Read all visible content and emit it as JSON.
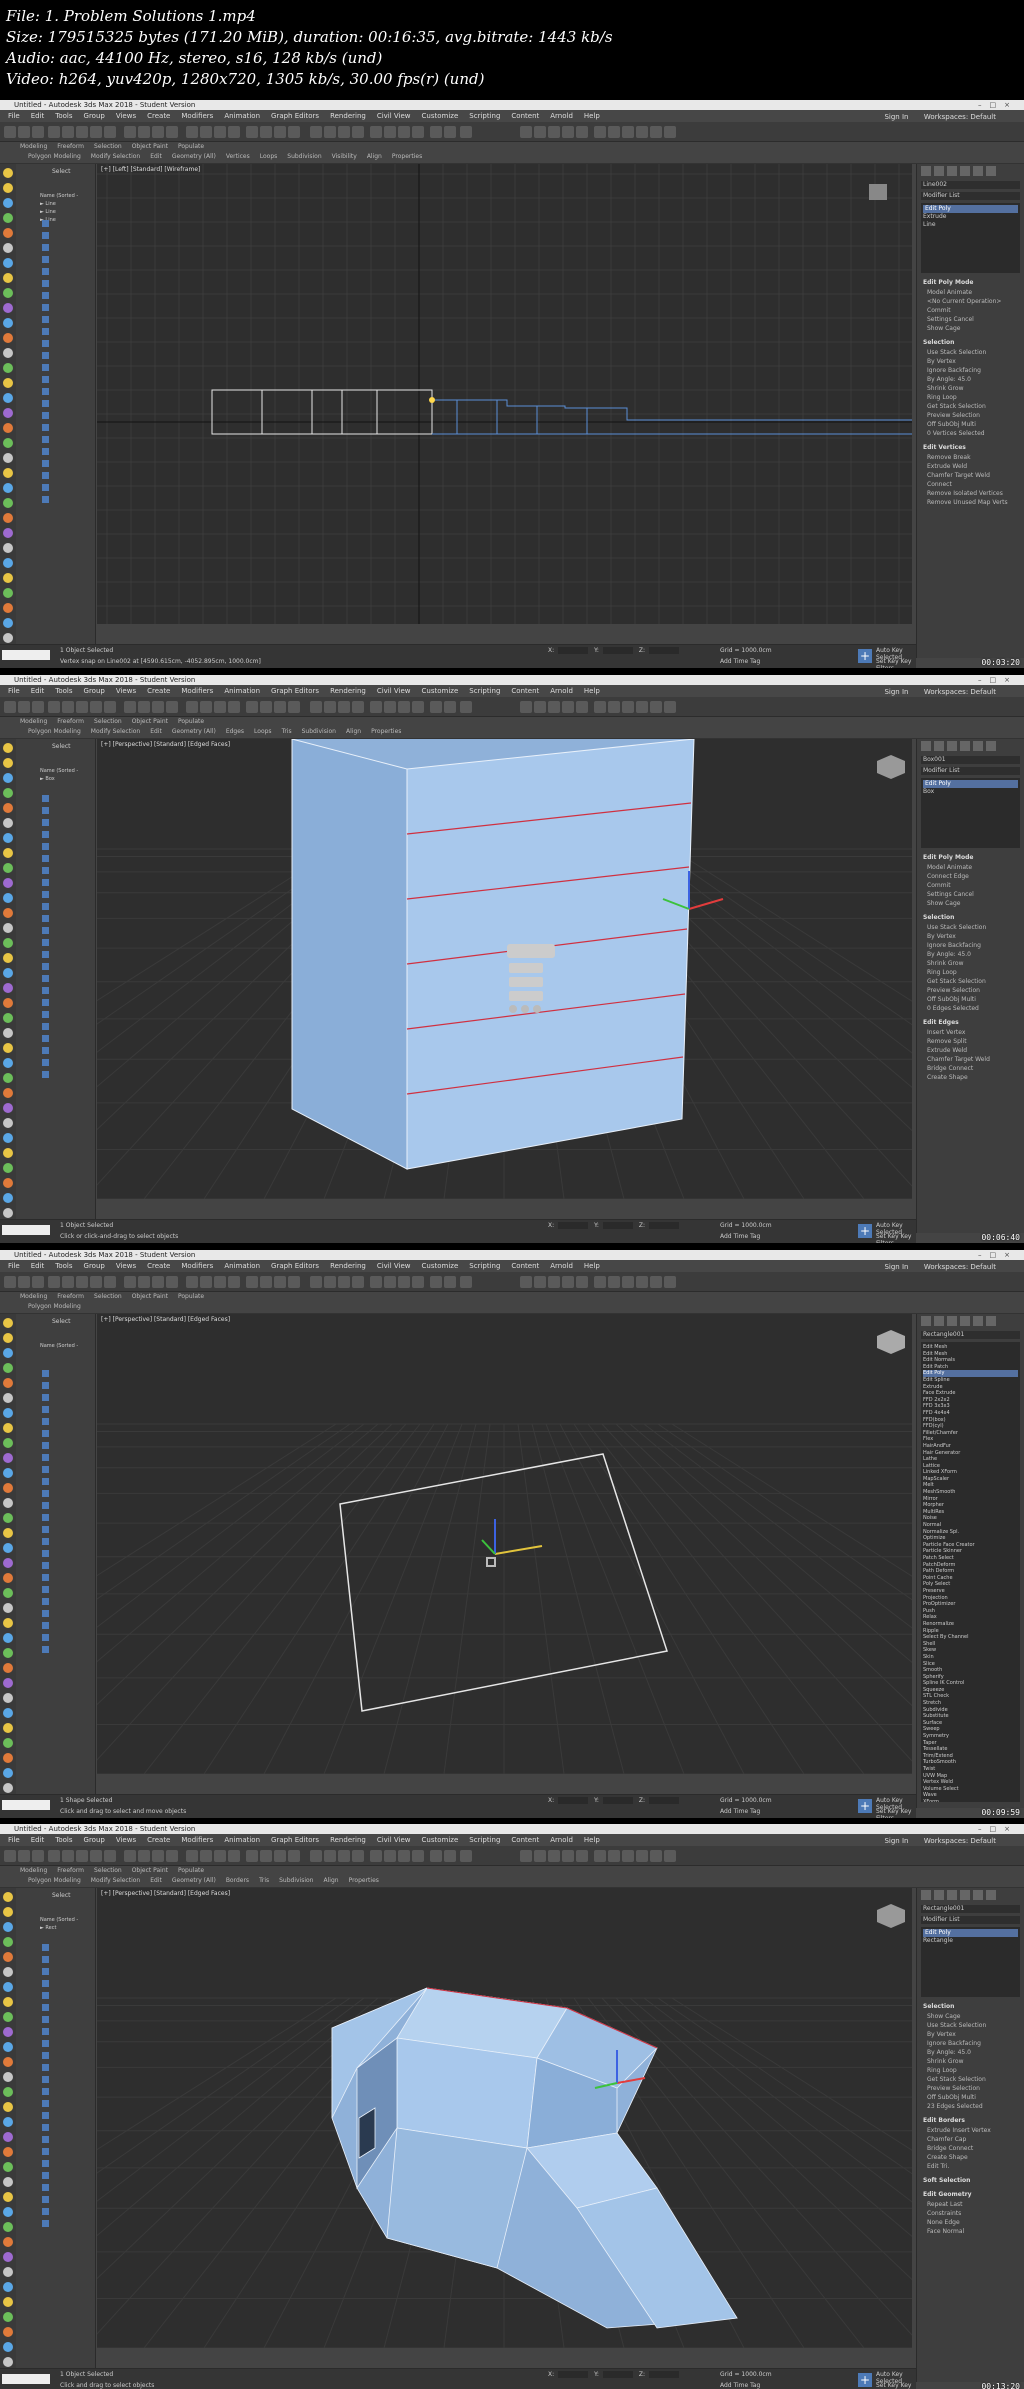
{
  "info": {
    "line1": "File: 1. Problem  Solutions 1.mp4",
    "line2": "Size: 179515325 bytes (171.20 MiB), duration: 00:16:35, avg.bitrate: 1443 kb/s",
    "line3": "Audio: aac, 44100 Hz, stereo, s16, 128 kb/s (und)",
    "line4": "Video: h264, yuv420p, 1280x720, 1305 kb/s, 30.00 fps(r) (und)"
  },
  "app": {
    "title": "Untitled - Autodesk 3ds Max 2018 - Student Version",
    "menus": [
      "File",
      "Edit",
      "Tools",
      "Group",
      "Views",
      "Create",
      "Modifiers",
      "Animation",
      "Graph Editors",
      "Rendering",
      "Civil View",
      "Customize",
      "Scripting",
      "Content",
      "Arnold",
      "Help"
    ],
    "signin": "Sign In",
    "workspaces": "Workspaces:  Default",
    "ribbon_tabs": [
      "Modeling",
      "Freeform",
      "Selection",
      "Object Paint",
      "Populate"
    ],
    "scene_select": "Select",
    "scene_name_col": "Name (Sorted -"
  },
  "frames": [
    {
      "id": "frame-1",
      "viewport_label": "[+] [Left] [Standard] [Wireframe]",
      "ribbon_sub": [
        "Polygon Modeling",
        "Modify Selection",
        "Edit",
        "Geometry (All)",
        "Vertices",
        "Loops",
        "Subdivision",
        "Visibility",
        "Align",
        "Properties"
      ],
      "object_name": "Line002",
      "modifier_list": "Modifier List",
      "stack": [
        "Edit Poly",
        "Extrude",
        "Line"
      ],
      "panel": [
        {
          "section": "Edit Poly Mode",
          "lines": [
            "Model   Animate",
            "<No Current Operation>",
            "Commit",
            "Settings   Cancel",
            "Show Cage"
          ]
        },
        {
          "section": "Selection",
          "lines": [
            "Use Stack Selection",
            "By Vertex",
            "Ignore Backfacing",
            "By Angle: 45.0",
            "Shrink   Grow",
            "Ring   Loop",
            "Get Stack Selection",
            "Preview Selection",
            "Off  SubObj  Multi",
            "0 Vertices Selected"
          ]
        },
        {
          "section": "Edit Vertices",
          "lines": [
            "Remove   Break",
            "Extrude   Weld",
            "Chamfer   Target Weld",
            "Connect",
            "Remove Isolated Vertices",
            "Remove Unused Map Verts"
          ]
        }
      ],
      "status1": "1 Object Selected",
      "status2": "Vertex snap on Line002 at [4590.615cm, -4052.895cm, 1000.0cm]",
      "grid": "Grid = 1000.0cm",
      "add_time_tag": "Add Time Tag",
      "auto_key": "Auto Key",
      "set_key": "Set Key",
      "selected": "Selected",
      "key_filters": "Key Filters...",
      "x_label": "X:",
      "y_label": "Y:",
      "z_label": "Z:",
      "timestamp": "00:03:20"
    },
    {
      "id": "frame-2",
      "viewport_label": "[+] [Perspective] [Standard] [Edged Faces]",
      "ribbon_sub": [
        "Polygon Modeling",
        "Modify Selection",
        "Edit",
        "Geometry (All)",
        "Edges",
        "Loops",
        "Tris",
        "Subdivision",
        "Align",
        "Properties"
      ],
      "object_name": "Box001",
      "modifier_list": "Modifier List",
      "stack": [
        "Edit Poly",
        "Box"
      ],
      "caddy_title": "Connect Edges",
      "caddy_values": [
        "1",
        "0",
        "0"
      ],
      "panel": [
        {
          "section": "Edit Poly Mode",
          "lines": [
            "Model   Animate",
            "Connect Edge",
            "Commit",
            "Settings   Cancel",
            "Show Cage"
          ]
        },
        {
          "section": "Selection",
          "lines": [
            "Use Stack Selection",
            "By Vertex",
            "Ignore Backfacing",
            "By Angle: 45.0",
            "Shrink   Grow",
            "Ring   Loop",
            "Get Stack Selection",
            "Preview Selection",
            "Off  SubObj  Multi",
            "0 Edges Selected"
          ]
        },
        {
          "section": "Edit Edges",
          "lines": [
            "Insert Vertex",
            "Remove   Split",
            "Extrude   Weld",
            "Chamfer   Target Weld",
            "Bridge   Connect",
            "Create Shape"
          ]
        }
      ],
      "status1": "1 Object Selected",
      "status2": "Click or click-and-drag to select objects",
      "grid": "Grid = 1000.0cm",
      "add_time_tag": "Add Time Tag",
      "auto_key": "Auto Key",
      "set_key": "Set Key",
      "selected": "Selected",
      "key_filters": "Key Filters...",
      "x_label": "X:",
      "y_label": "Y:",
      "z_label": "Z:",
      "timestamp": "00:06:40"
    },
    {
      "id": "frame-3",
      "viewport_label": "[+] [Perspective] [Standard] [Edged Faces]",
      "ribbon_sub": [
        "Polygon Modeling"
      ],
      "object_name": "Rectangle001",
      "modifier_list": "",
      "stack": [],
      "modifier_dropdown": [
        "Edit Mesh",
        "Edit Mesh",
        "Edit Normals",
        "Edit Patch",
        "Edit Poly",
        "Edit Spline",
        "Extrude",
        "Face Extrude",
        "FFD 2x2x2",
        "FFD 3x3x3",
        "FFD 4x4x4",
        "FFD(box)",
        "FFD(cyl)",
        "Fillet/Chamfer",
        "Flex",
        "HairAndFur",
        "Hair Generator",
        "Lathe",
        "Lattice",
        "Linked XForm",
        "MapScaler",
        "Melt",
        "MeshSmooth",
        "Mirror",
        "Morpher",
        "MultiRes",
        "Noise",
        "Normal",
        "Normalize Spl.",
        "Optimize",
        "Particle Face Creator",
        "Particle Skinner",
        "Patch Select",
        "PatchDeform",
        "Path Deform",
        "Point Cache",
        "Poly Select",
        "Preserve",
        "Projection",
        "ProOptimizer",
        "Push",
        "Relax",
        "Renormalize",
        "Ripple",
        "Select By Channel",
        "Shell",
        "Skew",
        "Skin",
        "Slice",
        "Smooth",
        "Spherify",
        "Spline IK Control",
        "Squeeze",
        "STL Check",
        "Stretch",
        "Subdivide",
        "Substitute",
        "Surface",
        "Sweep",
        "Symmetry",
        "Taper",
        "Tessellate",
        "Trim/Extend",
        "TurboSmooth",
        "Twist",
        "UVW Map",
        "Vertex Weld",
        "Volume Select",
        "Wave",
        "XForm"
      ],
      "status1": "1 Shape Selected",
      "status2": "Click and drag to select and move objects",
      "grid": "Grid = 1000.0cm",
      "add_time_tag": "Add Time Tag",
      "auto_key": "Auto Key",
      "set_key": "Set Key",
      "selected": "Selected",
      "key_filters": "Key Filters...",
      "x_label": "X:",
      "y_label": "Y:",
      "z_label": "Z:",
      "timestamp": "00:09:59"
    },
    {
      "id": "frame-4",
      "viewport_label": "[+] [Perspective] [Standard] [Edged Faces]",
      "ribbon_sub": [
        "Polygon Modeling",
        "Modify Selection",
        "Edit",
        "Geometry (All)",
        "Borders",
        "Tris",
        "Subdivision",
        "Align",
        "Properties"
      ],
      "object_name": "Rectangle001",
      "modifier_list": "Modifier List",
      "stack": [
        "Edit Poly",
        "Rectangle"
      ],
      "panel": [
        {
          "section": "Selection",
          "lines": [
            "Show Cage",
            "Use Stack Selection",
            "By Vertex",
            "Ignore Backfacing",
            "By Angle: 45.0",
            "Shrink   Grow",
            "Ring   Loop",
            "Get Stack Selection",
            "Preview Selection",
            "Off  SubObj  Multi",
            "23 Edges Selected"
          ]
        },
        {
          "section": "Edit Borders",
          "lines": [
            "Extrude   Insert Vertex",
            "Chamfer   Cap",
            "Bridge   Connect",
            "Create Shape",
            "Edit Tri."
          ]
        },
        {
          "section": "Soft Selection",
          "lines": []
        },
        {
          "section": "Edit Geometry",
          "lines": [
            "Repeat Last",
            "Constraints",
            "None   Edge",
            "Face   Normal"
          ]
        }
      ],
      "status1": "1 Object Selected",
      "status2": "Click and drag to select objects",
      "grid": "Grid = 1000.0cm",
      "add_time_tag": "Add Time Tag",
      "auto_key": "Auto Key",
      "set_key": "Set Key",
      "selected": "Selected",
      "key_filters": "Key Filters...",
      "x_label": "X:",
      "y_label": "Y:",
      "z_label": "Z:",
      "timestamp": "00:13:20"
    }
  ],
  "colors": {
    "ui_bg": "#444444",
    "viewport_bg": "#2e2e2e",
    "mesh_fill": "#a3c4e8",
    "accent_blue": "#4d7ab7",
    "edge_red": "#d03040"
  }
}
